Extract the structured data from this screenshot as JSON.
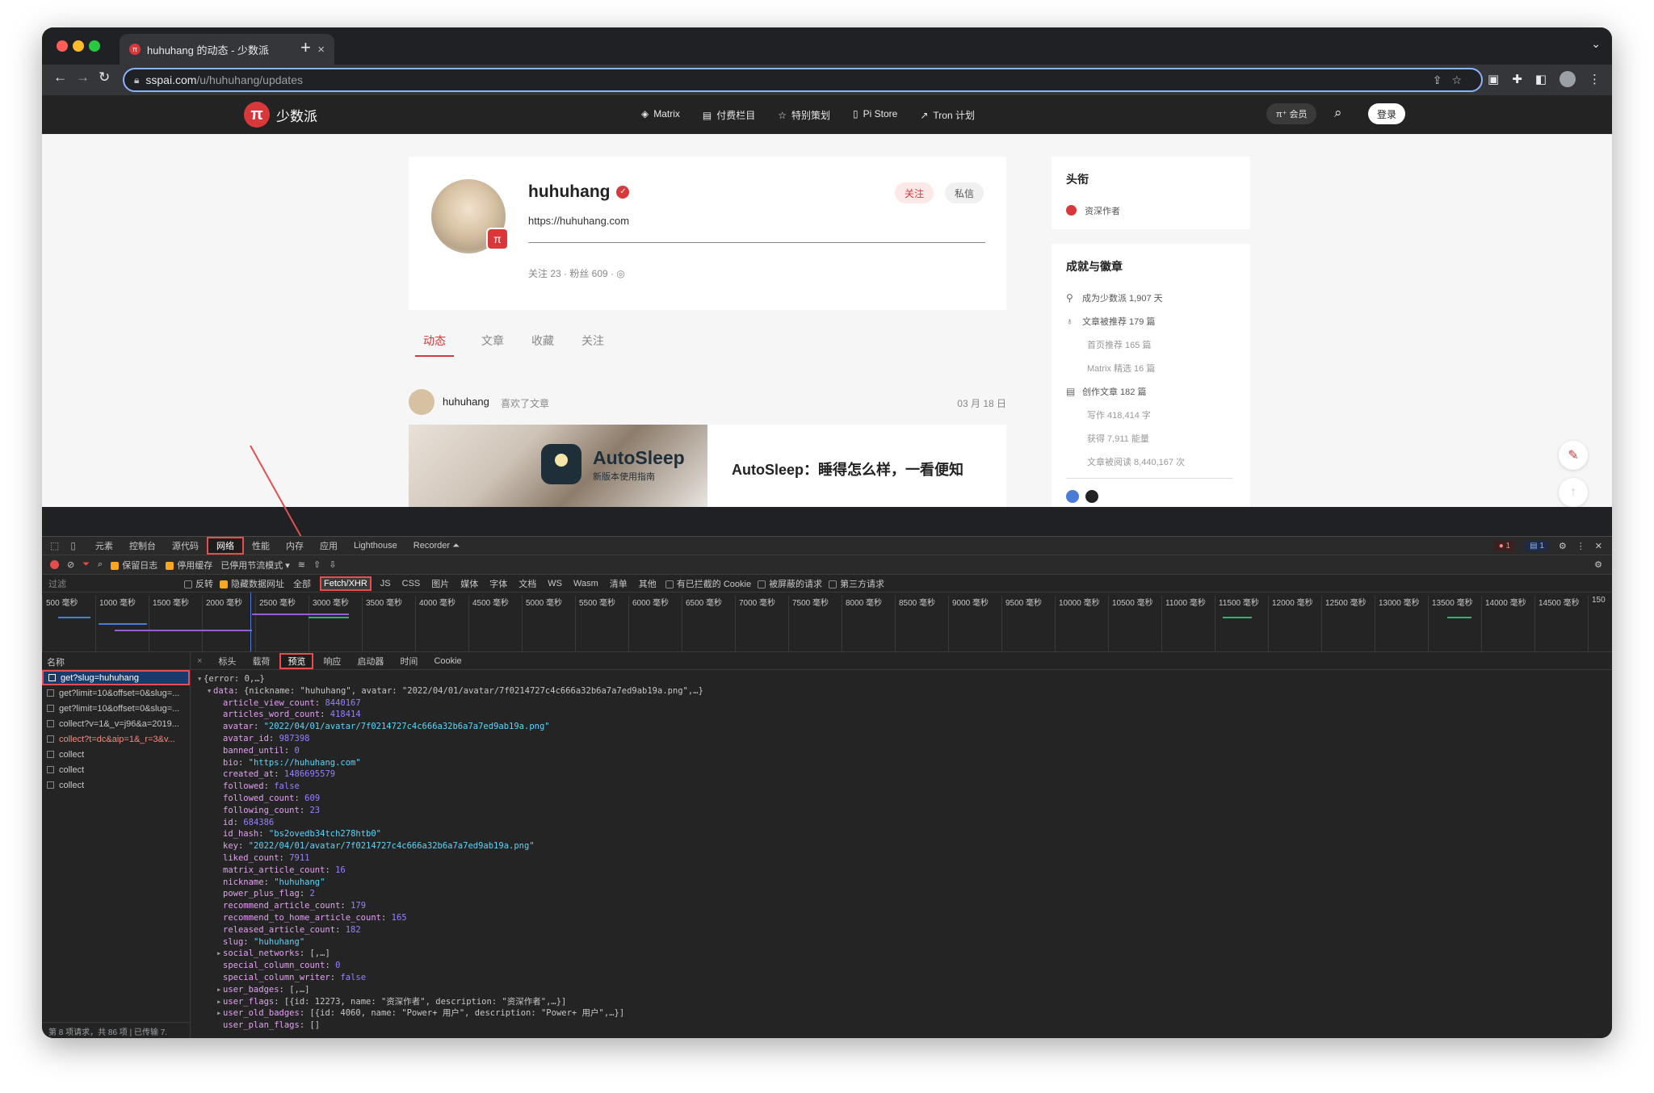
{
  "browser": {
    "tab_title": "huhuhang 的动态 - 少数派",
    "url_host": "sspai.com",
    "url_path": "/u/huhuhang/updates"
  },
  "site": {
    "logo_text": "少数派",
    "nav": [
      "Matrix",
      "付费栏目",
      "特别策划",
      "Pi Store",
      "Tron 计划"
    ],
    "member_label": "π⁺ 会员",
    "login_label": "登录"
  },
  "profile": {
    "name": "huhuhang",
    "bio": "https://huhuhang.com",
    "stats": "关注 23 · 粉丝 609 ·",
    "follow_label": "关注",
    "message_label": "私信",
    "tabs": [
      "动态",
      "文章",
      "收藏",
      "关注"
    ]
  },
  "feed": {
    "user": "huhuhang",
    "action": "喜欢了文章",
    "date": "03 月 18 日",
    "thumb_title": "AutoSleep",
    "thumb_sub": "新版本使用指南",
    "article_title": "AutoSleep：睡得怎么样，一看便知"
  },
  "sidebar": {
    "title_heading": "头衔",
    "title_item": "资深作者",
    "achieve_heading": "成就与徽章",
    "rows": [
      {
        "text": "成为少数派 1,907 天",
        "sub": false,
        "icon": "person-icon"
      },
      {
        "text": "文章被推荐 179 篇",
        "sub": false,
        "icon": "medal-icon"
      },
      {
        "text": "首页推荐 165 篇",
        "sub": true
      },
      {
        "text": "Matrix 精选 16 篇",
        "sub": true
      },
      {
        "text": "创作文章 182 篇",
        "sub": false,
        "icon": "document-icon"
      },
      {
        "text": "写作 418,414 字",
        "sub": true
      },
      {
        "text": "获得 7,911 能量",
        "sub": true
      },
      {
        "text": "文章被阅读 8,440,167 次",
        "sub": true
      }
    ]
  },
  "devtools": {
    "tabs": [
      "元素",
      "控制台",
      "源代码",
      "网络",
      "性能",
      "内存",
      "应用",
      "Lighthouse",
      "Recorder ⏶"
    ],
    "active_tab": "网络",
    "errors": "1",
    "messages": "1",
    "toolbar": {
      "preserve_log": "保留日志",
      "disable_cache": "停用缓存",
      "throttle": "已停用节流模式"
    },
    "filter": {
      "label": "过滤",
      "invert": "反转",
      "hide_data": "隐藏数据网址",
      "types": [
        "全部",
        "Fetch/XHR",
        "JS",
        "CSS",
        "图片",
        "媒体",
        "字体",
        "文档",
        "WS",
        "Wasm",
        "清单",
        "其他"
      ],
      "active_type": "Fetch/XHR",
      "blocked_cookies": "有已拦截的 Cookie",
      "blocked_requests": "被屏蔽的请求",
      "third_party": "第三方请求"
    },
    "timeline_ticks": [
      "500 毫秒",
      "1000 毫秒",
      "1500 毫秒",
      "2000 毫秒",
      "2500 毫秒",
      "3000 毫秒",
      "3500 毫秒",
      "4000 毫秒",
      "4500 毫秒",
      "5000 毫秒",
      "5500 毫秒",
      "6000 毫秒",
      "6500 毫秒",
      "7000 毫秒",
      "7500 毫秒",
      "8000 毫秒",
      "8500 毫秒",
      "9000 毫秒",
      "9500 毫秒",
      "10000 毫秒",
      "10500 毫秒",
      "11000 毫秒",
      "11500 毫秒",
      "12000 毫秒",
      "12500 毫秒",
      "13000 毫秒",
      "13500 毫秒",
      "14000 毫秒",
      "14500 毫秒",
      "150"
    ],
    "name_header": "名称",
    "requests": [
      {
        "name": "get?slug=huhuhang",
        "selected": true,
        "error": false
      },
      {
        "name": "get?limit=10&offset=0&slug=...",
        "selected": false,
        "error": false
      },
      {
        "name": "get?limit=10&offset=0&slug=...",
        "selected": false,
        "error": false
      },
      {
        "name": "collect?v=1&_v=j96&a=2019...",
        "selected": false,
        "error": false
      },
      {
        "name": "collect?t=dc&aip=1&_r=3&v...",
        "selected": false,
        "error": true
      },
      {
        "name": "collect",
        "selected": false,
        "error": false
      },
      {
        "name": "collect",
        "selected": false,
        "error": false
      },
      {
        "name": "collect",
        "selected": false,
        "error": false
      }
    ],
    "status": "第 8 项请求，共 86 项 | 已传输 7.",
    "detail_tabs": [
      "标头",
      "载荷",
      "预览",
      "响应",
      "启动器",
      "时间",
      "Cookie"
    ],
    "active_detail_tab": "预览",
    "json_lines": [
      {
        "indent": 0,
        "arrow": "▾",
        "key": "",
        "val": "{error: 0,…}",
        "type": "p"
      },
      {
        "indent": 1,
        "arrow": "▾",
        "key": "data",
        "val": "{nickname: \"huhuhang\", avatar: \"2022/04/01/avatar/7f0214727c4c666a32b6a7a7ed9ab19a.png\",…}",
        "type": "p"
      },
      {
        "indent": 2,
        "arrow": "",
        "key": "article_view_count",
        "val": "8440167",
        "type": "n"
      },
      {
        "indent": 2,
        "arrow": "",
        "key": "articles_word_count",
        "val": "418414",
        "type": "n"
      },
      {
        "indent": 2,
        "arrow": "",
        "key": "avatar",
        "val": "\"2022/04/01/avatar/7f0214727c4c666a32b6a7a7ed9ab19a.png\"",
        "type": "s"
      },
      {
        "indent": 2,
        "arrow": "",
        "key": "avatar_id",
        "val": "987398",
        "type": "n"
      },
      {
        "indent": 2,
        "arrow": "",
        "key": "banned_until",
        "val": "0",
        "type": "n"
      },
      {
        "indent": 2,
        "arrow": "",
        "key": "bio",
        "val": "\"https://huhuhang.com\"",
        "type": "s"
      },
      {
        "indent": 2,
        "arrow": "",
        "key": "created_at",
        "val": "1486695579",
        "type": "n"
      },
      {
        "indent": 2,
        "arrow": "",
        "key": "followed",
        "val": "false",
        "type": "b"
      },
      {
        "indent": 2,
        "arrow": "",
        "key": "followed_count",
        "val": "609",
        "type": "n"
      },
      {
        "indent": 2,
        "arrow": "",
        "key": "following_count",
        "val": "23",
        "type": "n"
      },
      {
        "indent": 2,
        "arrow": "",
        "key": "id",
        "val": "684386",
        "type": "n"
      },
      {
        "indent": 2,
        "arrow": "",
        "key": "id_hash",
        "val": "\"bs2ovedb34tch278htb0\"",
        "type": "s"
      },
      {
        "indent": 2,
        "arrow": "",
        "key": "key",
        "val": "\"2022/04/01/avatar/7f0214727c4c666a32b6a7a7ed9ab19a.png\"",
        "type": "s"
      },
      {
        "indent": 2,
        "arrow": "",
        "key": "liked_count",
        "val": "7911",
        "type": "n"
      },
      {
        "indent": 2,
        "arrow": "",
        "key": "matrix_article_count",
        "val": "16",
        "type": "n"
      },
      {
        "indent": 2,
        "arrow": "",
        "key": "nickname",
        "val": "\"huhuhang\"",
        "type": "s"
      },
      {
        "indent": 2,
        "arrow": "",
        "key": "power_plus_flag",
        "val": "2",
        "type": "n"
      },
      {
        "indent": 2,
        "arrow": "",
        "key": "recommend_article_count",
        "val": "179",
        "type": "n"
      },
      {
        "indent": 2,
        "arrow": "",
        "key": "recommend_to_home_article_count",
        "val": "165",
        "type": "n"
      },
      {
        "indent": 2,
        "arrow": "",
        "key": "released_article_count",
        "val": "182",
        "type": "n"
      },
      {
        "indent": 2,
        "arrow": "",
        "key": "slug",
        "val": "\"huhuhang\"",
        "type": "s"
      },
      {
        "indent": 2,
        "arrow": "▸",
        "key": "social_networks",
        "val": "[,…]",
        "type": "p"
      },
      {
        "indent": 2,
        "arrow": "",
        "key": "special_column_count",
        "val": "0",
        "type": "n"
      },
      {
        "indent": 2,
        "arrow": "",
        "key": "special_column_writer",
        "val": "false",
        "type": "b"
      },
      {
        "indent": 2,
        "arrow": "▸",
        "key": "user_badges",
        "val": "[,…]",
        "type": "p"
      },
      {
        "indent": 2,
        "arrow": "▸",
        "key": "user_flags",
        "val": "[{id: 12273, name: \"资深作者\", description: \"资深作者\",…}]",
        "type": "p"
      },
      {
        "indent": 2,
        "arrow": "▸",
        "key": "user_old_badges",
        "val": "[{id: 4060, name: \"Power+ 用户\", description: \"Power+ 用户\",…}]",
        "type": "p"
      },
      {
        "indent": 2,
        "arrow": "",
        "key": "user_plan_flags",
        "val": "[]",
        "type": "p"
      }
    ]
  }
}
